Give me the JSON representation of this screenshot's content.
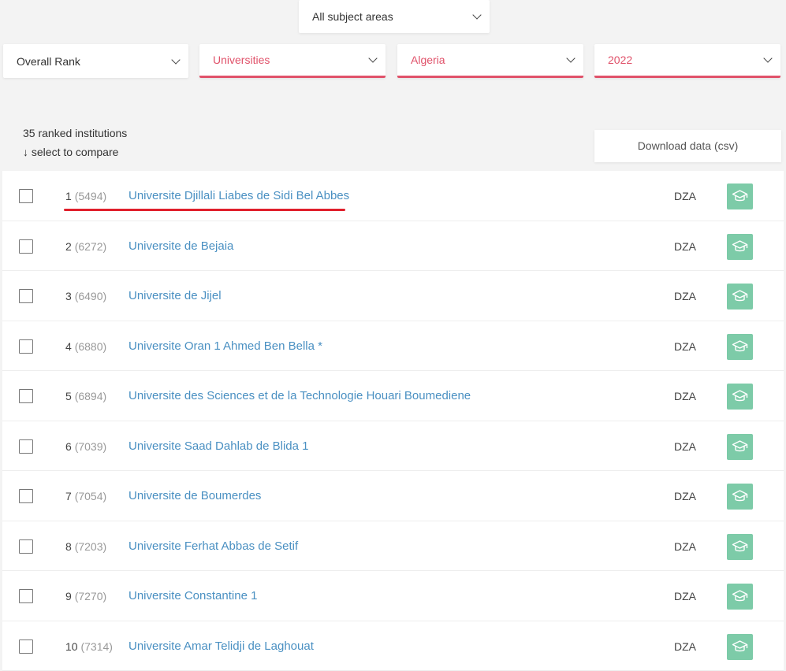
{
  "colors": {
    "accent": "#e0526a",
    "link": "#4a90c2",
    "icon_bg": "#7dcba8",
    "annotation": "#e0202c"
  },
  "filters": {
    "subject": "All subject areas",
    "rank": "Overall Rank",
    "type": "Universities",
    "country": "Algeria",
    "year": "2022"
  },
  "summary": {
    "count_label": "35 ranked institutions",
    "compare_label": "↓ select to compare"
  },
  "download": {
    "label": "Download data (csv)"
  },
  "rows": [
    {
      "rank": "1",
      "world": "(5494)",
      "name": "Universite Djillali Liabes de Sidi Bel Abbes",
      "country": "DZA"
    },
    {
      "rank": "2",
      "world": "(6272)",
      "name": "Universite de Bejaia",
      "country": "DZA"
    },
    {
      "rank": "3",
      "world": "(6490)",
      "name": "Universite de Jijel",
      "country": "DZA"
    },
    {
      "rank": "4",
      "world": "(6880)",
      "name": "Universite Oran 1 Ahmed Ben Bella *",
      "country": "DZA"
    },
    {
      "rank": "5",
      "world": "(6894)",
      "name": "Universite des Sciences et de la Technologie Houari Boumediene",
      "country": "DZA"
    },
    {
      "rank": "6",
      "world": "(7039)",
      "name": "Universite Saad Dahlab de Blida 1",
      "country": "DZA"
    },
    {
      "rank": "7",
      "world": "(7054)",
      "name": "Universite de Boumerdes",
      "country": "DZA"
    },
    {
      "rank": "8",
      "world": "(7203)",
      "name": "Universite Ferhat Abbas de Setif",
      "country": "DZA"
    },
    {
      "rank": "9",
      "world": "(7270)",
      "name": "Universite Constantine 1",
      "country": "DZA"
    },
    {
      "rank": "10",
      "world": "(7314)",
      "name": "Universite Amar Telidji de Laghouat",
      "country": "DZA"
    }
  ],
  "icons": {
    "select_arrow": "chevron-down-icon",
    "row_action": "graduation-cap-icon"
  }
}
